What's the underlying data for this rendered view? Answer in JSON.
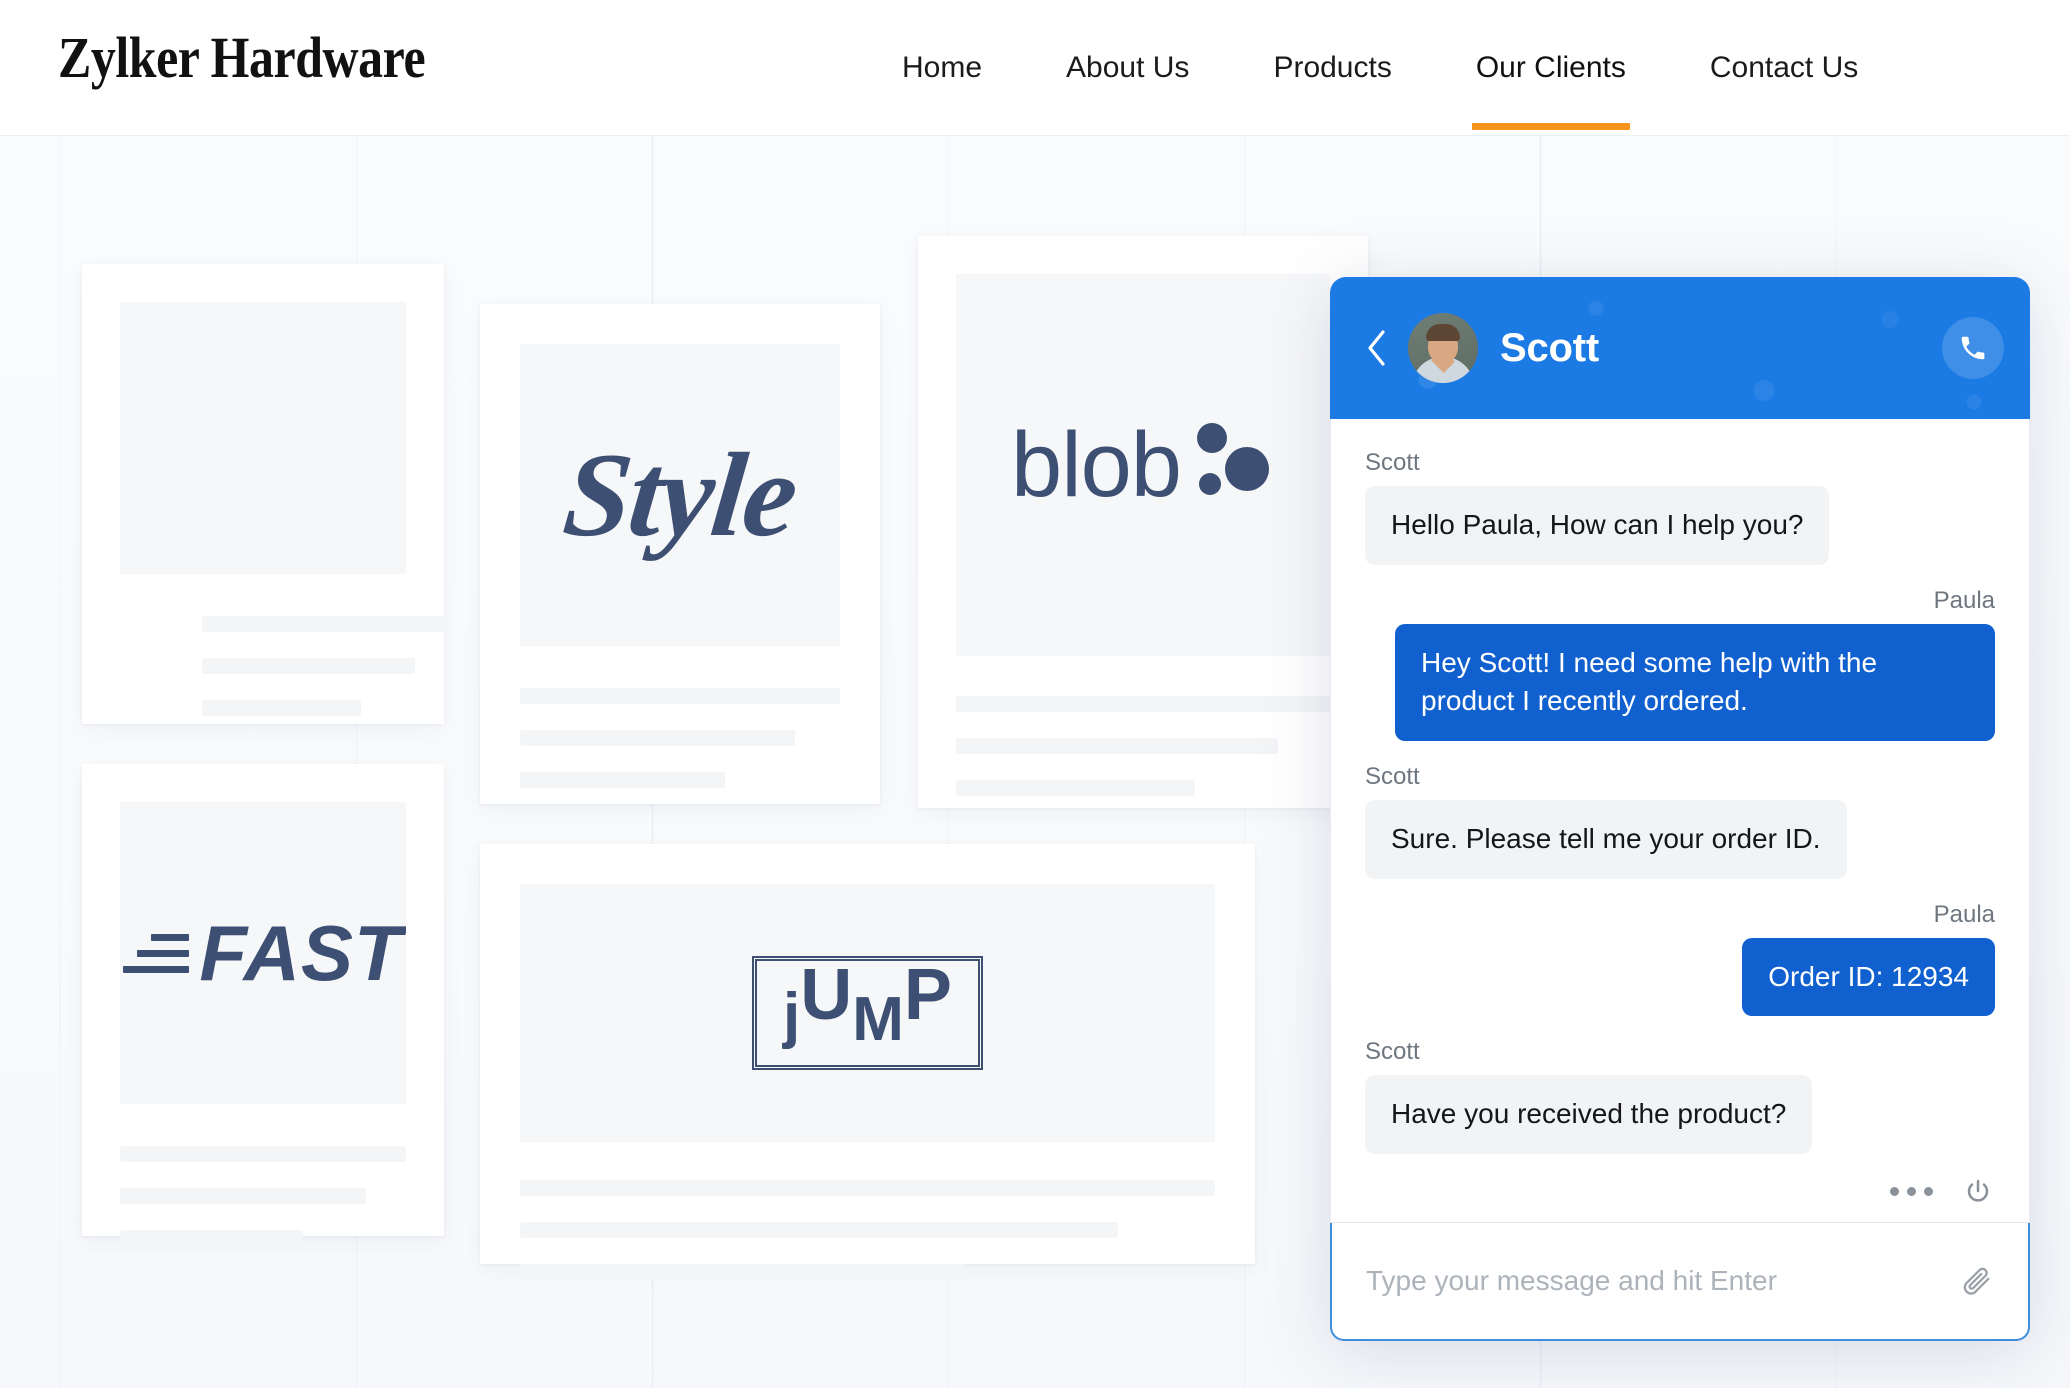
{
  "site": {
    "brand": "Zylker Hardware",
    "accent_orange": "#F7941E",
    "nav": [
      {
        "label": "Home",
        "active": false
      },
      {
        "label": "About Us",
        "active": false
      },
      {
        "label": "Products",
        "active": false
      },
      {
        "label": "Our Clients",
        "active": true
      },
      {
        "label": "Contact Us",
        "active": false
      }
    ]
  },
  "clients": {
    "cards": [
      {
        "logo_text": "",
        "logo_kind": "empty"
      },
      {
        "logo_text": "Style",
        "logo_kind": "style"
      },
      {
        "logo_text": "blob",
        "logo_kind": "blob"
      },
      {
        "logo_text": "FAST",
        "logo_kind": "fast"
      },
      {
        "logo_text": "JUMP",
        "logo_kind": "jump"
      }
    ],
    "logo_color": "#3d4f72",
    "jump_letters": {
      "j": "j",
      "u": "U",
      "m": "M",
      "p": "P"
    }
  },
  "chat": {
    "header": {
      "title": "Scott",
      "back_icon": "chevron-left-icon",
      "call_icon": "phone-icon",
      "avatar_alt": "Scott",
      "background_color": "#1b7ae4"
    },
    "messages": [
      {
        "sender": "Scott",
        "side": "left",
        "text": "Hello Paula, How can I help you?"
      },
      {
        "sender": "Paula",
        "side": "right",
        "text": "Hey Scott! I need some help with the product I recently ordered."
      },
      {
        "sender": "Scott",
        "side": "left",
        "text": "Sure. Please tell me your order ID."
      },
      {
        "sender": "Paula",
        "side": "right",
        "text": "Order ID: 12934"
      },
      {
        "sender": "Scott",
        "side": "left",
        "text": "Have you received the product?"
      }
    ],
    "actions": {
      "more_icon": "more-options-icon",
      "end_chat_icon": "power-icon"
    },
    "input": {
      "value": "",
      "placeholder": "Type your message and hit Enter",
      "attach_icon": "paperclip-icon"
    },
    "bubble_colors": {
      "agent": "#f2f3f5",
      "visitor": "#1060cf"
    }
  }
}
